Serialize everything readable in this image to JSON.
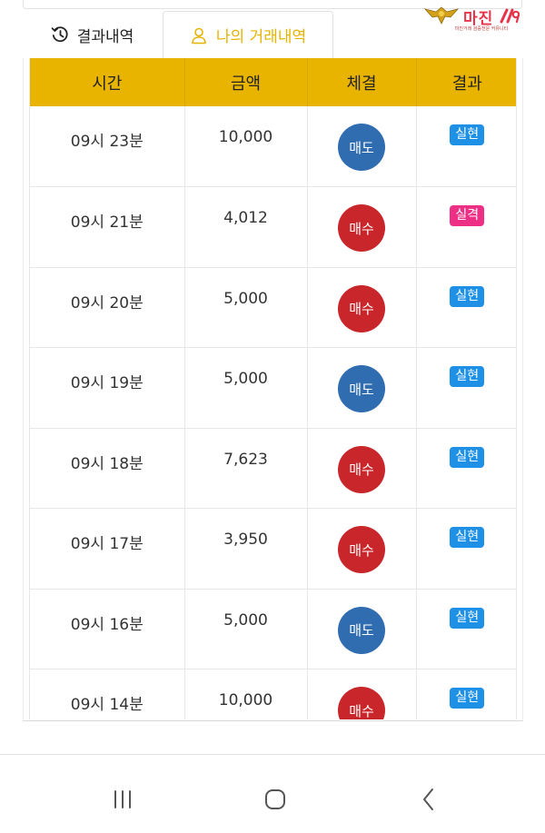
{
  "tabs": [
    {
      "label": "결과내역",
      "icon": "history-icon",
      "active": false
    },
    {
      "label": "나의 거래내역",
      "icon": "user-icon",
      "active": true
    }
  ],
  "logo": {
    "brand": "마진",
    "tagline": "마진거래 검증전문 커뮤니티",
    "accent_color": "#e8334a"
  },
  "table": {
    "headers": [
      "시간",
      "금액",
      "체결",
      "결과"
    ],
    "rows": [
      {
        "time": "09시 23분",
        "amount": "10,000",
        "trade": "매도",
        "result": "실현"
      },
      {
        "time": "09시 21분",
        "amount": "4,012",
        "trade": "매수",
        "result": "실격"
      },
      {
        "time": "09시 20분",
        "amount": "5,000",
        "trade": "매수",
        "result": "실현"
      },
      {
        "time": "09시 19분",
        "amount": "5,000",
        "trade": "매도",
        "result": "실현"
      },
      {
        "time": "09시 18분",
        "amount": "7,623",
        "trade": "매수",
        "result": "실현"
      },
      {
        "time": "09시 17분",
        "amount": "3,950",
        "trade": "매수",
        "result": "실현"
      },
      {
        "time": "09시 16분",
        "amount": "5,000",
        "trade": "매도",
        "result": "실현"
      },
      {
        "time": "09시 14분",
        "amount": "10,000",
        "trade": "매수",
        "result": "실현"
      }
    ]
  },
  "colors": {
    "header_bg": "#e8b400",
    "active_tab": "#e6b400",
    "sell": "#2f6db0",
    "buy": "#c8262a",
    "result_win": "#1e90e6",
    "result_lose": "#ee2f86"
  },
  "navbar": {
    "buttons": [
      {
        "icon": "recent-apps-icon"
      },
      {
        "icon": "home-icon"
      },
      {
        "icon": "back-icon"
      }
    ]
  }
}
